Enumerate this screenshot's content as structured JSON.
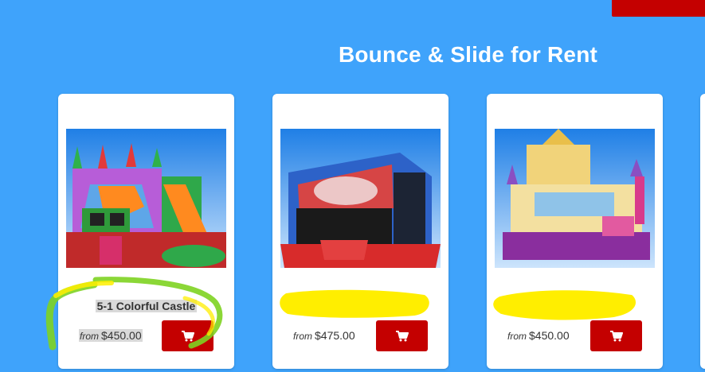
{
  "page": {
    "title": "Bounce & Slide for Rent"
  },
  "products": [
    {
      "title": "5-1 Colorful Castle",
      "price_prefix": "from",
      "price": "$450.00",
      "cart_icon": "cart-icon"
    },
    {
      "title": "",
      "price_prefix": "from",
      "price": "$475.00",
      "cart_icon": "cart-icon"
    },
    {
      "title": "",
      "price_prefix": "from",
      "price": "$450.00",
      "cart_icon": "cart-icon"
    }
  ],
  "colors": {
    "background": "#3fa3fb",
    "button": "#c40000",
    "card": "#ffffff",
    "highlighter_yellow": "#ffee00",
    "highlighter_green": "#7ed321"
  }
}
